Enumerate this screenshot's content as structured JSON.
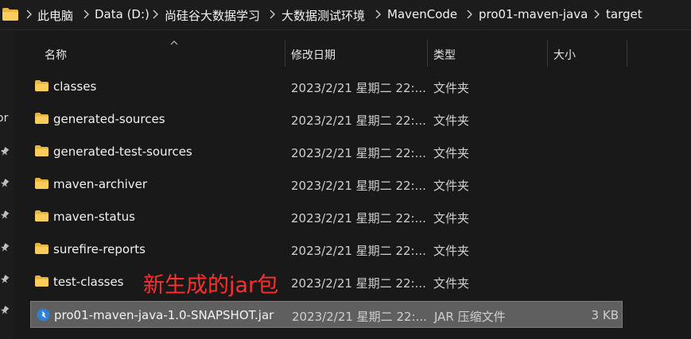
{
  "breadcrumb": {
    "segments": [
      "此电脑",
      "Data (D:)",
      "尚硅谷大数据学习",
      "大数据测试环境",
      "MavenCode",
      "pro01-maven-java",
      "target"
    ]
  },
  "left_pane": {
    "partial_text": "or"
  },
  "columns": {
    "name": "名称",
    "modified": "修改日期",
    "type": "类型",
    "size": "大小"
  },
  "files": [
    {
      "name": "classes",
      "modified": "2023/2/21 星期二 22:...",
      "type": "文件夹",
      "size": "",
      "icon": "folder-icon"
    },
    {
      "name": "generated-sources",
      "modified": "2023/2/21 星期二 22:...",
      "type": "文件夹",
      "size": "",
      "icon": "folder-icon"
    },
    {
      "name": "generated-test-sources",
      "modified": "2023/2/21 星期二 22:...",
      "type": "文件夹",
      "size": "",
      "icon": "folder-icon"
    },
    {
      "name": "maven-archiver",
      "modified": "2023/2/21 星期二 22:...",
      "type": "文件夹",
      "size": "",
      "icon": "folder-icon"
    },
    {
      "name": "maven-status",
      "modified": "2023/2/21 星期二 22:...",
      "type": "文件夹",
      "size": "",
      "icon": "folder-icon"
    },
    {
      "name": "surefire-reports",
      "modified": "2023/2/21 星期二 22:...",
      "type": "文件夹",
      "size": "",
      "icon": "folder-icon"
    },
    {
      "name": "test-classes",
      "modified": "2023/2/21 星期二 22:...",
      "type": "文件夹",
      "size": "",
      "icon": "folder-icon"
    },
    {
      "name": "pro01-maven-java-1.0-SNAPSHOT.jar",
      "modified": "2023/2/21 星期二 22:...",
      "type": "JAR 压缩文件",
      "size": "3 KB",
      "icon": "jar-file-icon",
      "selected": true
    }
  ],
  "annotation": {
    "text": "新生成的jar包",
    "color": "#ff2e2e"
  },
  "colors": {
    "folder": "#f5c24c",
    "selection": "#5f5f5f",
    "background": "#191919"
  }
}
